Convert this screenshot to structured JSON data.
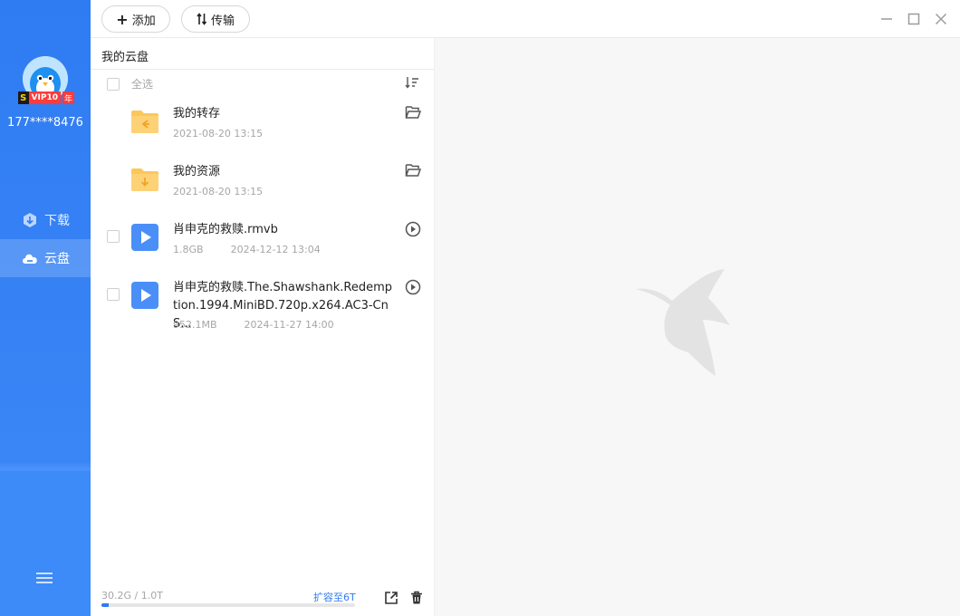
{
  "user": {
    "phone": "177****8476",
    "vip_s": "S",
    "vip_label": "VIP10",
    "vip_year": "年"
  },
  "nav": [
    {
      "label": "下载",
      "icon": "download-icon"
    },
    {
      "label": "云盘",
      "icon": "cloud-icon",
      "active": true
    }
  ],
  "toolbar": {
    "add_label": "添加",
    "transfer_label": "传输"
  },
  "panel": {
    "breadcrumb": "我的云盘",
    "select_all": "全选",
    "files": [
      {
        "name": "我的转存",
        "type": "folder",
        "date": "2021-08-20 13:15",
        "size": ""
      },
      {
        "name": "我的资源",
        "type": "folder",
        "date": "2021-08-20 13:15",
        "size": ""
      },
      {
        "name": "肖申克的救赎.rmvb",
        "type": "video",
        "size": "1.8GB",
        "date": "2024-12-12 13:04"
      },
      {
        "name": "肖申克的救赎.The.Shawshank.Redemption.1994.MiniBD.720p.x264.AC3-CnS...",
        "type": "video",
        "size": "952.1MB",
        "date": "2024-11-27 14:00"
      }
    ],
    "quota_text": "30.2G / 1.0T",
    "quota_used_fraction": 0.03,
    "expand_label": "扩容至6T"
  },
  "colors": {
    "accent": "#2f7bf2",
    "folder": "#fcc75a",
    "video": "#4a8ff7"
  }
}
